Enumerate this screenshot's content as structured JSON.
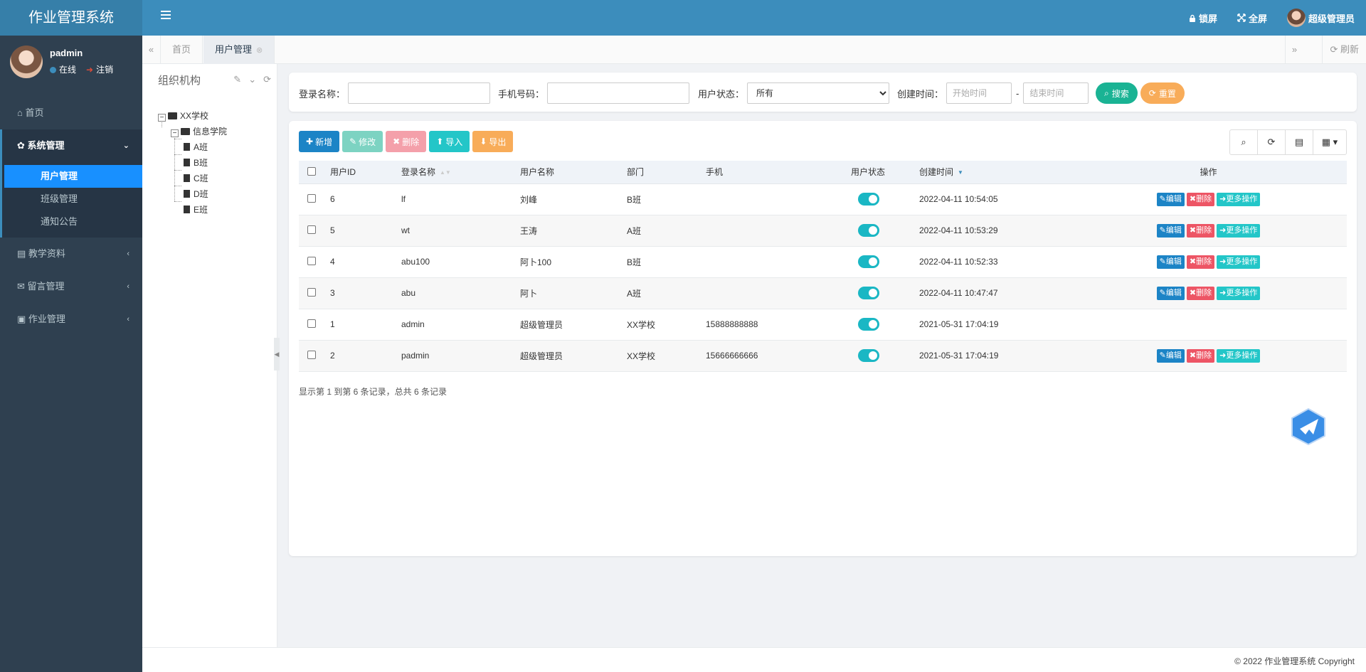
{
  "app": {
    "title": "作业管理系统"
  },
  "header": {
    "lock_label": "锁屏",
    "fullscreen_label": "全屏",
    "user_label": "超级管理员"
  },
  "sidebar": {
    "user": {
      "name": "padmin",
      "status": "在线",
      "logout": "注销"
    },
    "menu": [
      {
        "label": "首页",
        "icon": "home-icon"
      },
      {
        "label": "系统管理",
        "icon": "gear-icon",
        "expanded": true,
        "children": [
          "用户管理",
          "班级管理",
          "通知公告"
        ],
        "current": "用户管理"
      },
      {
        "label": "教学资料",
        "icon": "book-icon"
      },
      {
        "label": "留言管理",
        "icon": "message-icon"
      },
      {
        "label": "作业管理",
        "icon": "id-card-icon"
      }
    ]
  },
  "tabs": {
    "items": [
      "首页",
      "用户管理"
    ],
    "active": "用户管理",
    "refresh_label": "刷新"
  },
  "org": {
    "title": "组织机构",
    "tree": {
      "root": "XX学校",
      "college": "信息学院",
      "classes": [
        "A班",
        "B班",
        "C班",
        "D班",
        "E班"
      ]
    }
  },
  "search": {
    "login_name_label": "登录名称：",
    "phone_label": "手机号码：",
    "status_label": "用户状态：",
    "status_value": "所有",
    "created_label": "创建时间：",
    "start_placeholder": "开始时间",
    "separator": "-",
    "end_placeholder": "结束时间",
    "search_btn": "搜索",
    "reset_btn": "重置"
  },
  "toolbar": {
    "add": "新增",
    "edit": "修改",
    "delete": "删除",
    "import": "导入",
    "export": "导出"
  },
  "table": {
    "columns": [
      "用户ID",
      "登录名称",
      "用户名称",
      "部门",
      "手机",
      "用户状态",
      "创建时间",
      "操作"
    ],
    "rows": [
      {
        "id": "6",
        "login": "lf",
        "name": "刘峰",
        "dept": "B班",
        "phone": "",
        "enabled": true,
        "created": "2022-04-11 10:54:05",
        "ops": true
      },
      {
        "id": "5",
        "login": "wt",
        "name": "王涛",
        "dept": "A班",
        "phone": "",
        "enabled": true,
        "created": "2022-04-11 10:53:29",
        "ops": true
      },
      {
        "id": "4",
        "login": "abu100",
        "name": "阿卜100",
        "dept": "B班",
        "phone": "",
        "enabled": true,
        "created": "2022-04-11 10:52:33",
        "ops": true
      },
      {
        "id": "3",
        "login": "abu",
        "name": "阿卜",
        "dept": "A班",
        "phone": "",
        "enabled": true,
        "created": "2022-04-11 10:47:47",
        "ops": true
      },
      {
        "id": "1",
        "login": "admin",
        "name": "超级管理员",
        "dept": "XX学校",
        "phone": "15888888888",
        "enabled": true,
        "created": "2021-05-31 17:04:19",
        "ops": false
      },
      {
        "id": "2",
        "login": "padmin",
        "name": "超级管理员",
        "dept": "XX学校",
        "phone": "15666666666",
        "enabled": true,
        "created": "2021-05-31 17:04:19",
        "ops": true
      }
    ],
    "op_edit": "编辑",
    "op_delete": "删除",
    "op_more": "更多操作",
    "page_info": "显示第 1 到第 6 条记录，总共 6 条记录"
  },
  "footer": {
    "copyright": "© 2022 作业管理系统 Copyright"
  },
  "colors": {
    "header": "#3c8dbc",
    "sidebar": "#2f4050",
    "active_sub": "#1890ff",
    "toggle": "#1ab7c4",
    "edit": "#1c84c6",
    "delete": "#ed5565",
    "more": "#23c6c8",
    "search": "#1ab394",
    "reset": "#f8ac59"
  }
}
